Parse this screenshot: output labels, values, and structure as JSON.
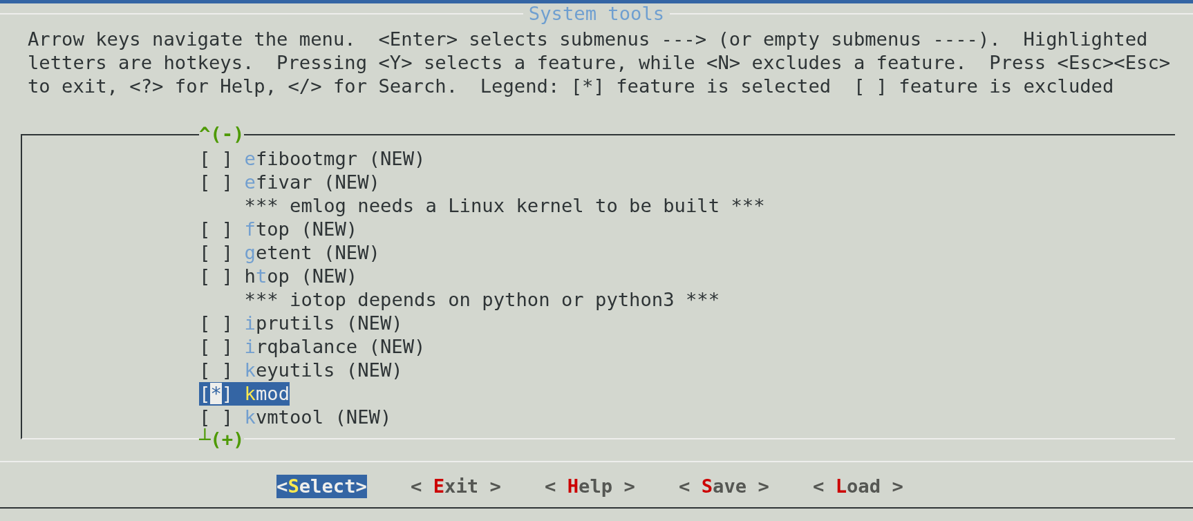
{
  "title": "System tools",
  "help_lines": [
    "Arrow keys navigate the menu.  <Enter> selects submenus ---> (or empty submenus ----).  Highlighted",
    "letters are hotkeys.  Pressing <Y> selects a feature, while <N> excludes a feature.  Press <Esc><Esc>",
    "to exit, <?> for Help, </> for Search.  Legend: [*] feature is selected  [ ] feature is excluded"
  ],
  "scroll_up": "^(-)",
  "scroll_down": "┴(+)",
  "items": [
    {
      "kind": "option",
      "box": "[ ]",
      "label": "**e**fibootmgr (NEW)",
      "selected": false
    },
    {
      "kind": "option",
      "box": "[ ]",
      "label": "**e**fivar (NEW)",
      "selected": false
    },
    {
      "kind": "comment",
      "label": "*** emlog needs a Linux kernel to be built ***",
      "selected": false
    },
    {
      "kind": "option",
      "box": "[ ]",
      "label": "**f**top (NEW)",
      "selected": false
    },
    {
      "kind": "option",
      "box": "[ ]",
      "label": "**g**etent (NEW)",
      "selected": false
    },
    {
      "kind": "option",
      "box": "[ ]",
      "label": "h**t**op (NEW)",
      "selected": false
    },
    {
      "kind": "comment",
      "label": "*** iotop depends on python or python3 ***",
      "selected": false
    },
    {
      "kind": "option",
      "box": "[ ]",
      "label": "**i**prutils (NEW)",
      "selected": false
    },
    {
      "kind": "option",
      "box": "[ ]",
      "label": "**i**rqbalance (NEW)",
      "selected": false
    },
    {
      "kind": "option",
      "box": "[ ]",
      "label": "**k**eyutils (NEW)",
      "selected": false
    },
    {
      "kind": "option",
      "box": "[*]",
      "label": "**k**mod",
      "selected": true
    },
    {
      "kind": "option",
      "box": "[ ]",
      "label": "**k**vmtool (NEW)",
      "selected": false
    }
  ],
  "buttons": [
    {
      "label": "<**S**elect>",
      "selected": true
    },
    {
      "label": "< **E**xit >",
      "selected": false
    },
    {
      "label": "< **H**elp >",
      "selected": false
    },
    {
      "label": "< **S**ave >",
      "selected": false
    },
    {
      "label": "< **L**oad >",
      "selected": false
    }
  ]
}
